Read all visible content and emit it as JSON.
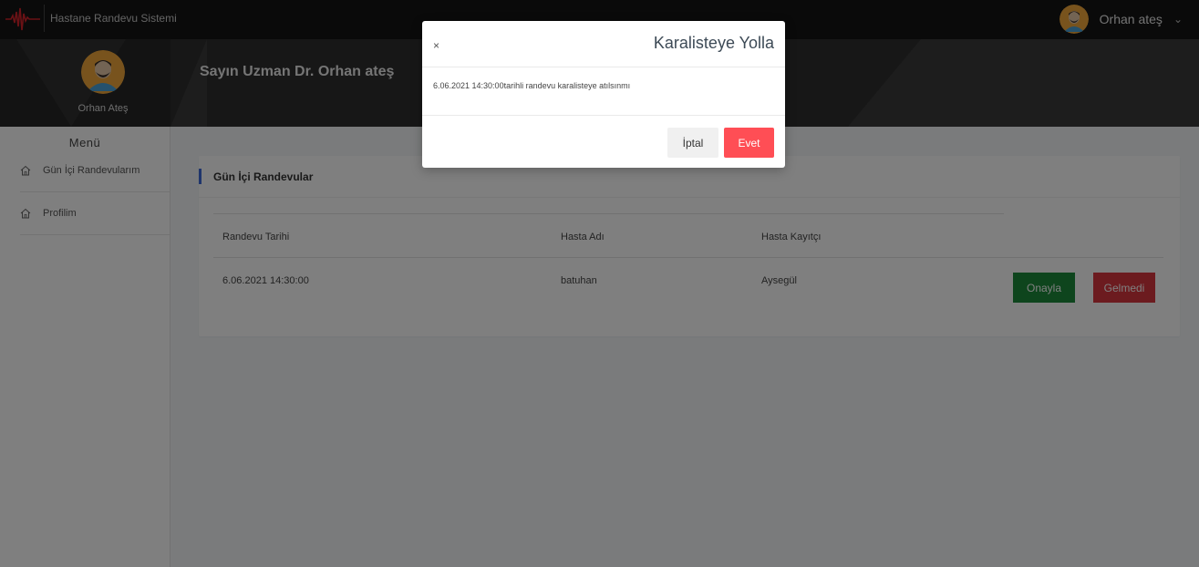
{
  "app": {
    "name": "Hastane Randevu Sistemi"
  },
  "topbar": {
    "user_name": "Orhan ateş",
    "avatar_icon": "avatar-icon",
    "chevron_icon": "chevron-down-icon"
  },
  "header": {
    "title": "Sayın Uzman Dr. Orhan ateş"
  },
  "sidebar": {
    "profile_name": "Orhan Ateş",
    "menu_title": "Menü",
    "items": [
      {
        "label": "Gün İçi Randevularım",
        "icon": "home-icon"
      },
      {
        "label": "Profilim",
        "icon": "home-icon"
      }
    ]
  },
  "card": {
    "title": "Gün İçi Randevular",
    "columns": [
      "Randevu Tarihi",
      "Hasta Adı",
      "Hasta Kayıtçı"
    ],
    "rows": [
      {
        "date": "6.06.2021 14:30:00",
        "patient": "batuhan",
        "registrar": "Aysegül",
        "approve_label": "Onayla",
        "noshow_label": "Gelmedi"
      }
    ]
  },
  "modal": {
    "close_label": "×",
    "title": "Karalisteye Yolla",
    "body": "6.06.2021 14:30:00tarihli randevu karalisteye atılsınmı",
    "cancel_label": "İptal",
    "confirm_label": "Evet"
  },
  "colors": {
    "accent": "#3f6ad8",
    "approve": "#1c8a3a",
    "danger": "#d9363e",
    "confirm": "#ff4e55",
    "topbar": "#141414"
  }
}
